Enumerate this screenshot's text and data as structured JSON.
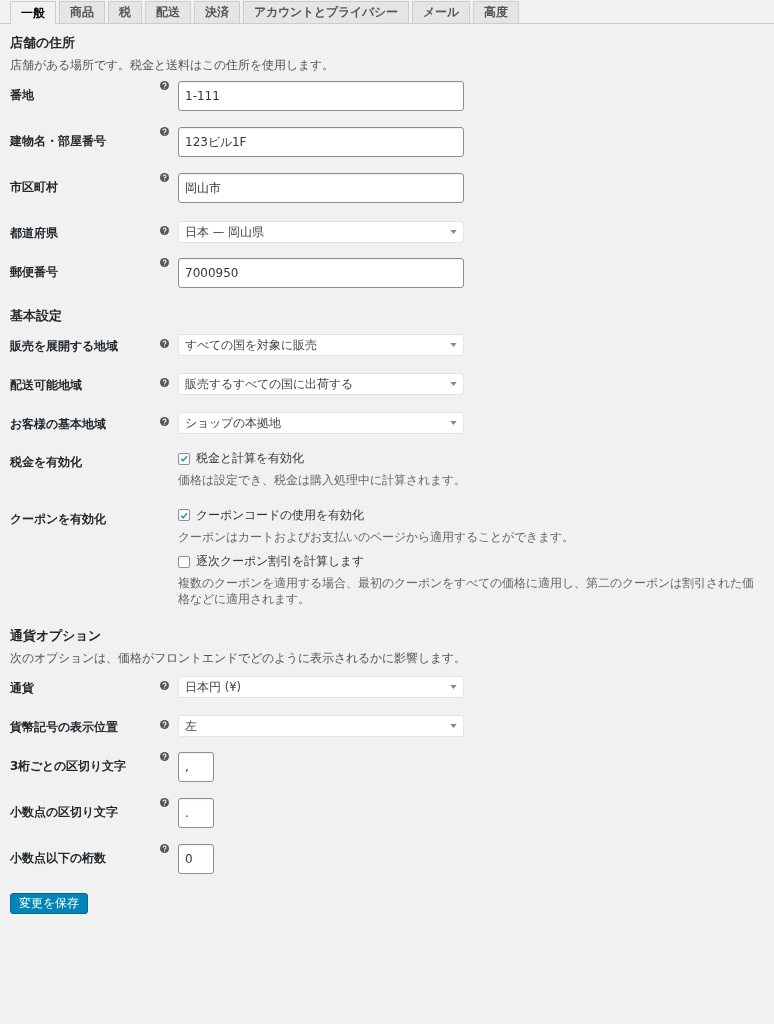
{
  "tabs": [
    {
      "label": "一般",
      "selected": true
    },
    {
      "label": "商品",
      "selected": false
    },
    {
      "label": "税",
      "selected": false
    },
    {
      "label": "配送",
      "selected": false
    },
    {
      "label": "決済",
      "selected": false
    },
    {
      "label": "アカウントとプライバシー",
      "selected": false
    },
    {
      "label": "メール",
      "selected": false
    },
    {
      "label": "高度",
      "selected": false
    }
  ],
  "sections": [
    {
      "title": "店舗の住所",
      "description": "店舗がある場所です。税金と送料はこの住所を使用します。",
      "rows": [
        {
          "kind": "text",
          "label": "番地",
          "value": "1-111"
        },
        {
          "kind": "text",
          "label": "建物名・部屋番号",
          "value": "123ビル1F"
        },
        {
          "kind": "text",
          "label": "市区町村",
          "value": "岡山市"
        },
        {
          "kind": "select",
          "label": "都道府県",
          "value": "日本 — 岡山県"
        },
        {
          "kind": "text",
          "label": "郵便番号",
          "value": "7000950"
        }
      ]
    },
    {
      "title": "基本設定",
      "rows": [
        {
          "kind": "select",
          "label": "販売を展開する地域",
          "value": "すべての国を対象に販売"
        },
        {
          "kind": "select",
          "label": "配送可能地域",
          "value": "販売するすべての国に出荷する"
        },
        {
          "kind": "select",
          "label": "お客様の基本地域",
          "value": "ショップの本拠地"
        },
        {
          "kind": "checkbox",
          "label": "税金を有効化",
          "options": [
            {
              "label": "税金と計算を有効化",
              "checked": true,
              "description": "価格は設定でき、税金は購入処理中に計算されます。"
            }
          ]
        },
        {
          "kind": "checkbox",
          "label": "クーポンを有効化",
          "options": [
            {
              "label": "クーポンコードの使用を有効化",
              "checked": true,
              "description": "クーポンはカートおよびお支払いのページから適用することができます。"
            },
            {
              "label": "逐次クーポン割引を計算します",
              "checked": false,
              "description": "複数のクーポンを適用する場合、最初のクーポンをすべての価格に適用し、第二のクーポンは割引された価格などに適用されます。"
            }
          ]
        }
      ]
    },
    {
      "title": "通貨オプション",
      "description": "次のオプションは、価格がフロントエンドでどのように表示されるかに影響します。",
      "rows": [
        {
          "kind": "select",
          "label": "通貨",
          "value": "日本円 (¥)"
        },
        {
          "kind": "select",
          "label": "貨幣記号の表示位置",
          "value": "左"
        },
        {
          "kind": "small",
          "label": "3桁ごとの区切り文字",
          "value": ","
        },
        {
          "kind": "small",
          "label": "小数点の区切り文字",
          "value": "."
        },
        {
          "kind": "small",
          "label": "小数点以下の桁数",
          "value": "0"
        }
      ]
    }
  ],
  "save_button": "変更を保存"
}
